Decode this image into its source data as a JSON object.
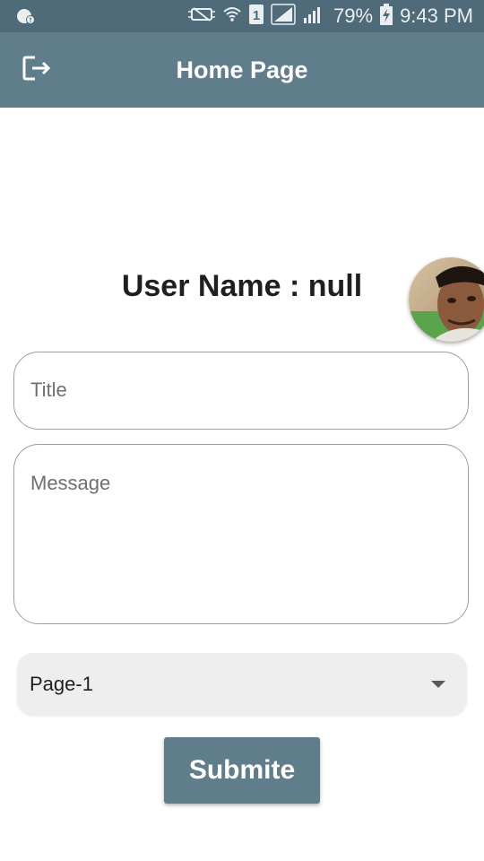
{
  "status_bar": {
    "battery_percent": "79%",
    "time": "9:43 PM",
    "sim_slot": "1",
    "icons": [
      "notification-icon",
      "mute-icon",
      "wifi-icon",
      "sim-icon",
      "signal-icon",
      "signal-icon",
      "battery-charging-icon"
    ]
  },
  "app_bar": {
    "title": "Home Page",
    "leading_icon": "logout-icon"
  },
  "user": {
    "name_label": "User Name : null"
  },
  "form": {
    "title_placeholder": "Title",
    "title_value": "",
    "message_placeholder": "Message",
    "message_value": "",
    "page_select": {
      "selected": "Page-1"
    },
    "submit_label": "Submite"
  },
  "colors": {
    "status_bar": "#4f6a78",
    "app_bar": "#607d8b",
    "button": "#607d8b",
    "dropdown_bg": "#eeeeee",
    "field_border": "#9e9e9e"
  }
}
